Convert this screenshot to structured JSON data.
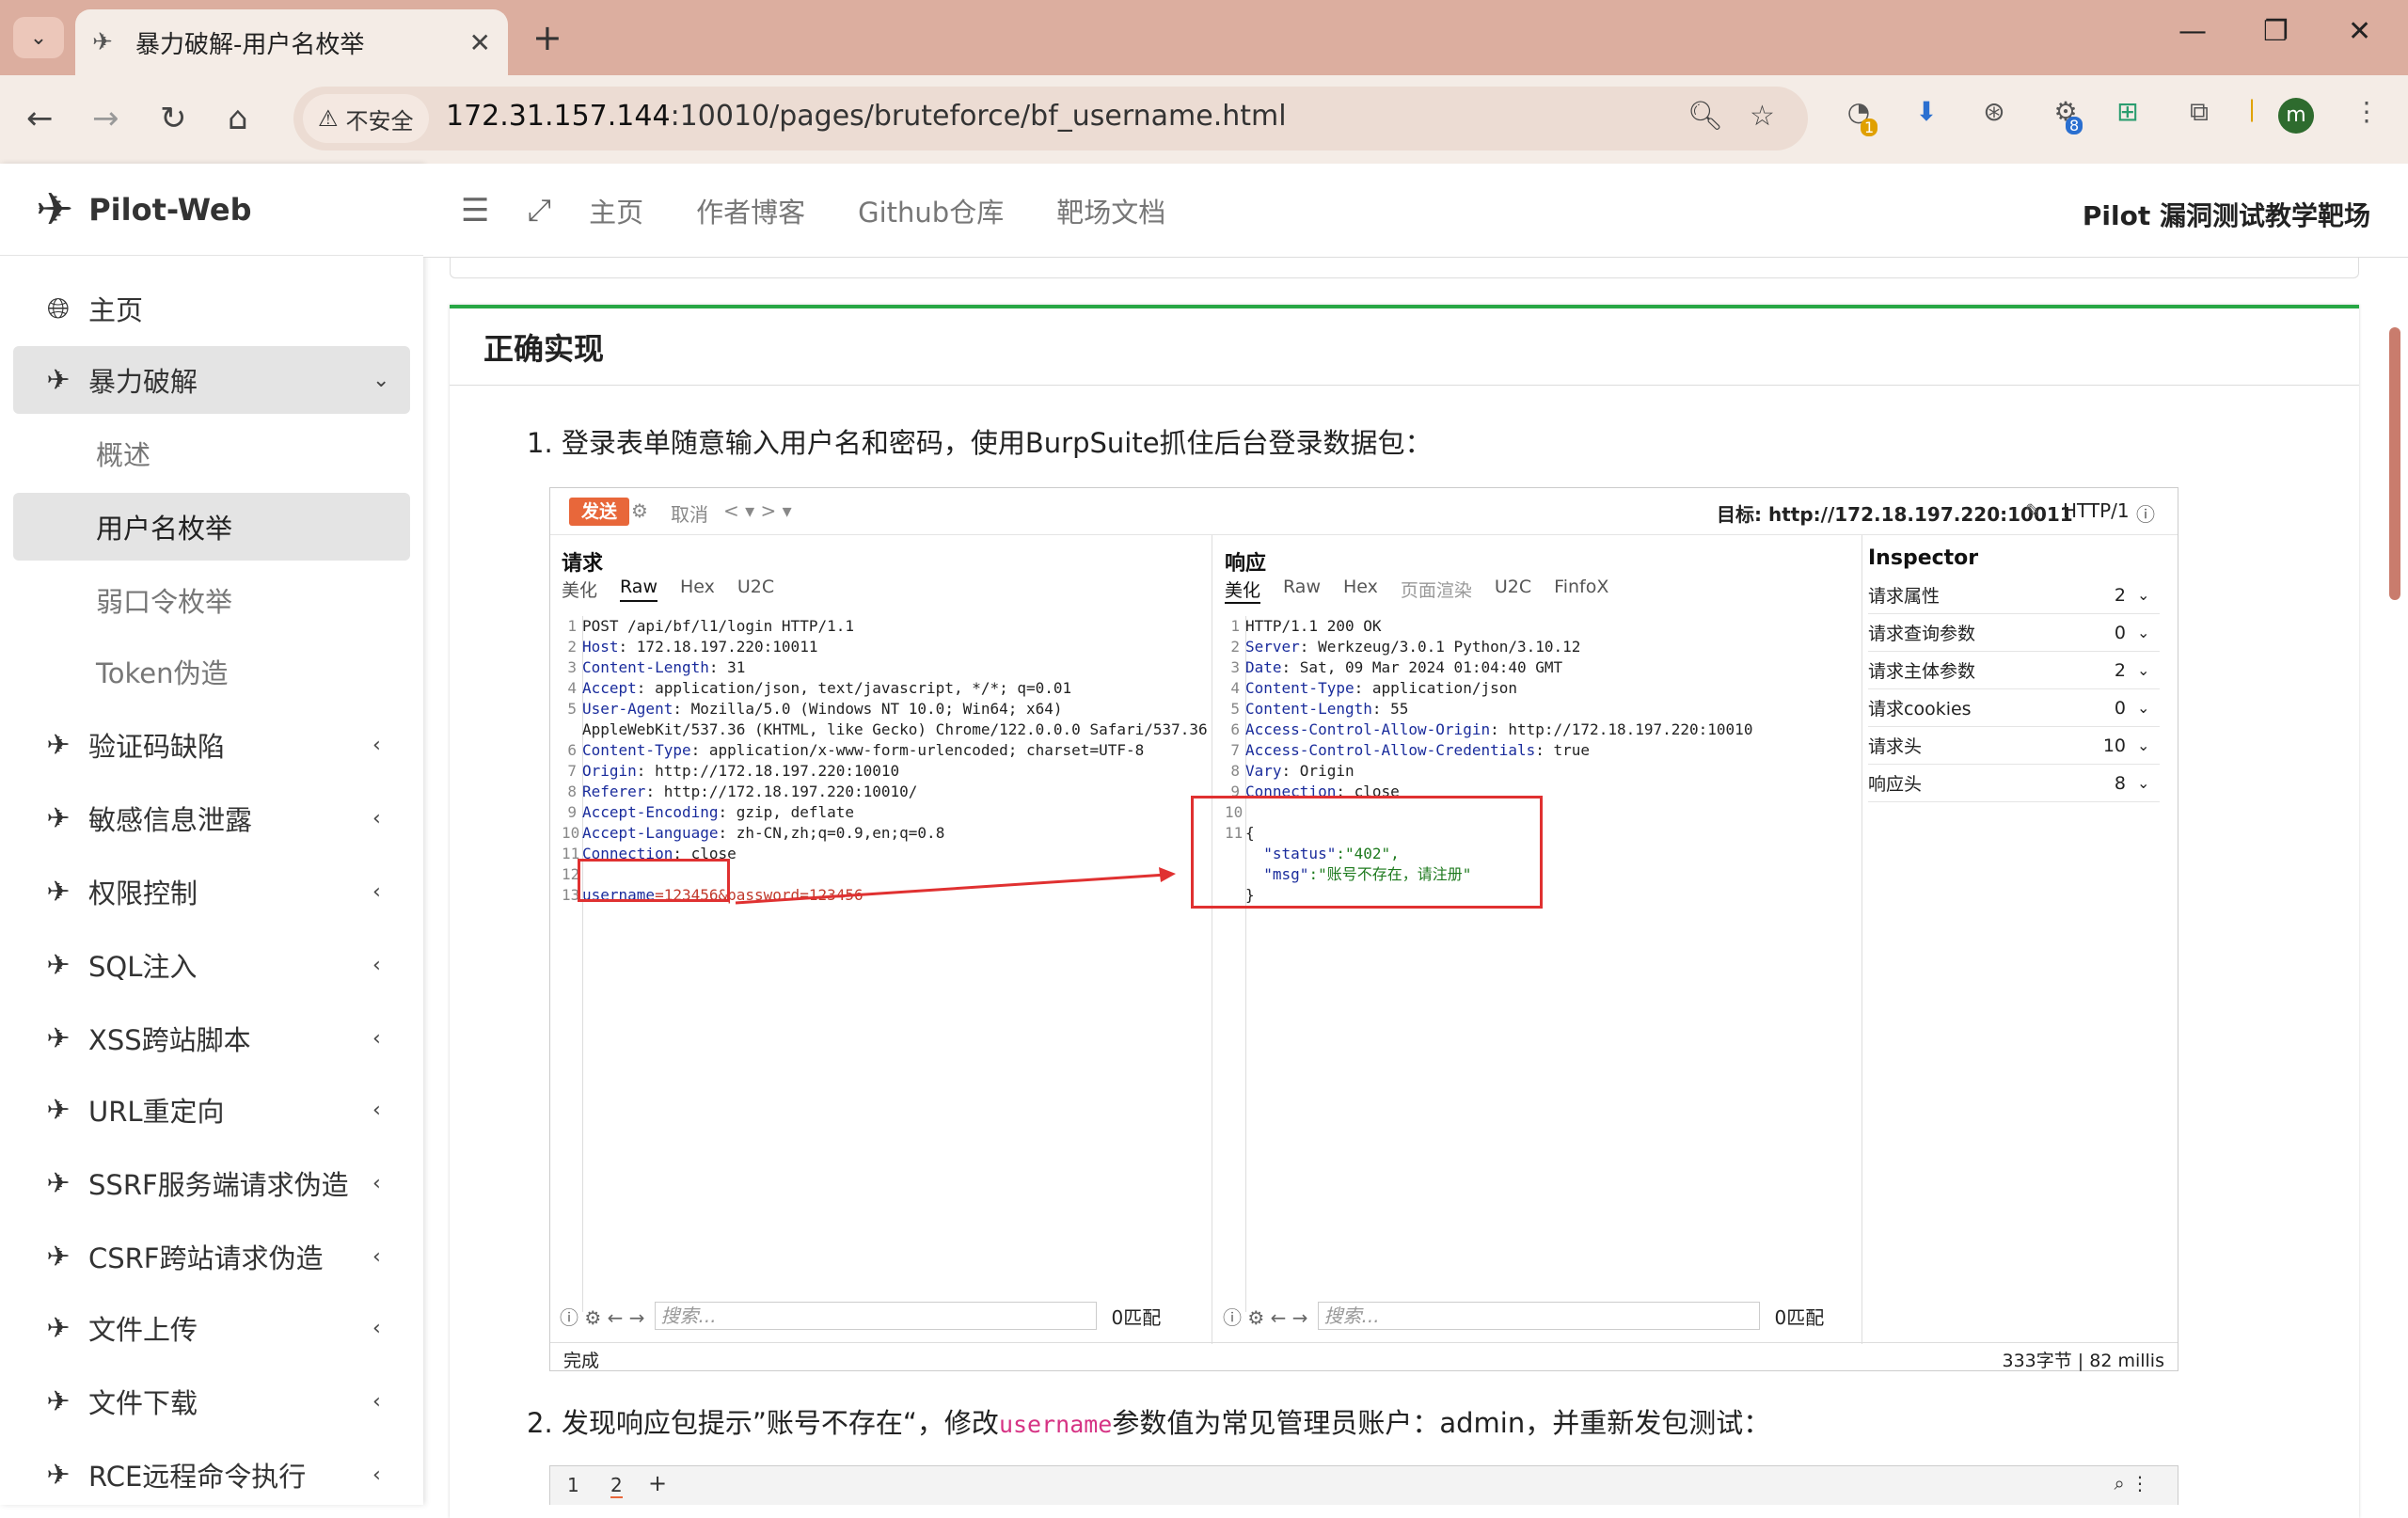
{
  "browser": {
    "tab_title": "暴力破解-用户名枚举",
    "insecure_label": "不安全",
    "url_host": "172.31.157.144",
    "url_rest": ":10010/pages/bruteforce/bf_username.html",
    "ext_badge_1": "1",
    "ext_badge_2": "8",
    "profile_initial": "m"
  },
  "sidebar": {
    "brand": "Pilot-Web",
    "items": [
      {
        "label": "主页",
        "icon": "globe-icon"
      },
      {
        "label": "暴力破解",
        "icon": "plane-icon"
      },
      {
        "label": "验证码缺陷",
        "icon": "plane-icon"
      },
      {
        "label": "敏感信息泄露",
        "icon": "plane-icon"
      },
      {
        "label": "权限控制",
        "icon": "plane-icon"
      },
      {
        "label": "SQL注入",
        "icon": "plane-icon"
      },
      {
        "label": "XSS跨站脚本",
        "icon": "plane-icon"
      },
      {
        "label": "URL重定向",
        "icon": "plane-icon"
      },
      {
        "label": "SSRF服务端请求伪造",
        "icon": "plane-icon"
      },
      {
        "label": "CSRF跨站请求伪造",
        "icon": "plane-icon"
      },
      {
        "label": "文件上传",
        "icon": "plane-icon"
      },
      {
        "label": "文件下载",
        "icon": "plane-icon"
      },
      {
        "label": "RCE远程命令执行",
        "icon": "plane-icon"
      }
    ],
    "subitems": [
      "概述",
      "用户名枚举",
      "弱口令枚举",
      "Token伪造"
    ]
  },
  "topnav": {
    "links": [
      "主页",
      "作者博客",
      "Github仓库",
      "靶场文档"
    ],
    "site_title": "Pilot 漏洞测试教学靶场"
  },
  "content": {
    "card_title": "正确实现",
    "step1": "1. 登录表单随意输入用户名和密码，使用BurpSuite抓住后台登录数据包：",
    "step2_pre": "2. 发现响应包提示”账号不存在“，修改",
    "step2_code": "username",
    "step2_post": "参数值为常见管理员账户：admin，并重新发包测试："
  },
  "burp": {
    "send": "发送",
    "cancel": "取消",
    "target": "目标: http://172.18.197.220:10011",
    "http_version": "HTTP/1",
    "request_title": "请求",
    "response_title": "响应",
    "req_tabs": [
      "美化",
      "Raw",
      "Hex",
      "U2C"
    ],
    "resp_tabs": [
      "美化",
      "Raw",
      "Hex",
      "页面渲染",
      "U2C",
      "FinfoX"
    ],
    "req_lines": [
      {
        "n": "1",
        "k": "",
        "v": "POST /api/bf/l1/login HTTP/1.1"
      },
      {
        "n": "2",
        "k": "Host",
        "v": ": 172.18.197.220:10011"
      },
      {
        "n": "3",
        "k": "Content-Length",
        "v": ": 31"
      },
      {
        "n": "4",
        "k": "Accept",
        "v": ": application/json, text/javascript, */*; q=0.01"
      },
      {
        "n": "5",
        "k": "User-Agent",
        "v": ": Mozilla/5.0 (Windows NT 10.0; Win64; x64)"
      },
      {
        "n": "",
        "k": "",
        "v": "AppleWebKit/537.36 (KHTML, like Gecko) Chrome/122.0.0.0 Safari/537.36"
      },
      {
        "n": "6",
        "k": "Content-Type",
        "v": ": application/x-www-form-urlencoded; charset=UTF-8"
      },
      {
        "n": "7",
        "k": "Origin",
        "v": ": http://172.18.197.220:10010"
      },
      {
        "n": "8",
        "k": "Referer",
        "v": ": http://172.18.197.220:10010/"
      },
      {
        "n": "9",
        "k": "Accept-Encoding",
        "v": ": gzip, deflate"
      },
      {
        "n": "10",
        "k": "Accept-Language",
        "v": ": zh-CN,zh;q=0.9,en;q=0.8"
      },
      {
        "n": "11",
        "k": "Connection",
        "v": ": close"
      },
      {
        "n": "12",
        "k": "",
        "v": ""
      },
      {
        "n": "13",
        "k": "username",
        "v": "=123456&password=123456"
      }
    ],
    "resp_lines": [
      {
        "n": "1",
        "k": "",
        "v": "HTTP/1.1 200 OK"
      },
      {
        "n": "2",
        "k": "Server",
        "v": ": Werkzeug/3.0.1 Python/3.10.12"
      },
      {
        "n": "3",
        "k": "Date",
        "v": ": Sat, 09 Mar 2024 01:04:40 GMT"
      },
      {
        "n": "4",
        "k": "Content-Type",
        "v": ": application/json"
      },
      {
        "n": "5",
        "k": "Content-Length",
        "v": ": 55"
      },
      {
        "n": "6",
        "k": "Access-Control-Allow-Origin",
        "v": ": http://172.18.197.220:10010"
      },
      {
        "n": "7",
        "k": "Access-Control-Allow-Credentials",
        "v": ": true"
      },
      {
        "n": "8",
        "k": "Vary",
        "v": ": Origin"
      },
      {
        "n": "9",
        "k": "Connection",
        "v": ": close"
      },
      {
        "n": "10",
        "k": "",
        "v": ""
      },
      {
        "n": "11",
        "k": "",
        "v": "{"
      },
      {
        "n": "",
        "k": "  \"status\"",
        "v": ":\"402\","
      },
      {
        "n": "",
        "k": "  \"msg\"",
        "v": ":\"账号不存在，请注册\""
      },
      {
        "n": "",
        "k": "",
        "v": "}"
      }
    ],
    "search_placeholder": "搜索...",
    "match_count": "0匹配",
    "inspector_title": "Inspector",
    "inspector_rows": [
      {
        "name": "请求属性",
        "count": "2"
      },
      {
        "name": "请求查询参数",
        "count": "0"
      },
      {
        "name": "请求主体参数",
        "count": "2"
      },
      {
        "name": "请求cookies",
        "count": "0"
      },
      {
        "name": "请求头",
        "count": "10"
      },
      {
        "name": "响应头",
        "count": "8"
      }
    ],
    "status_left": "完成",
    "status_right": "333字节 | 82 millis",
    "tabs2": [
      "1",
      "2"
    ]
  }
}
